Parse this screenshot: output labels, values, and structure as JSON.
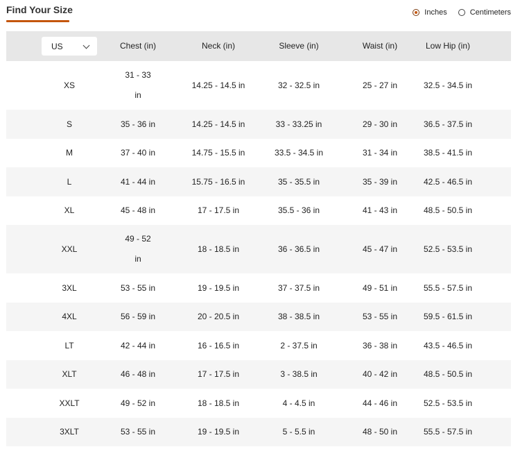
{
  "header": {
    "title": "Find Your Size",
    "units": [
      {
        "label": "Inches",
        "selected": true
      },
      {
        "label": "Centimeters",
        "selected": false
      }
    ]
  },
  "table": {
    "region_select": "US",
    "columns": [
      "Chest (in)",
      "Neck (in)",
      "Sleeve (in)",
      "Waist (in)",
      "Low Hip (in)"
    ],
    "rows": [
      {
        "size": "XS",
        "chest": [
          "31 - 33",
          "in"
        ],
        "neck": "14.25 - 14.5 in",
        "sleeve": "32 - 32.5 in",
        "waist": "25 - 27 in",
        "hip": "32.5 - 34.5 in"
      },
      {
        "size": "S",
        "chest": [
          "35 - 36 in"
        ],
        "neck": "14.25 - 14.5 in",
        "sleeve": "33 - 33.25 in",
        "waist": "29 - 30 in",
        "hip": "36.5 - 37.5 in"
      },
      {
        "size": "M",
        "chest": [
          "37 - 40 in"
        ],
        "neck": "14.75 - 15.5 in",
        "sleeve": "33.5 - 34.5 in",
        "waist": "31 - 34 in",
        "hip": "38.5 - 41.5 in"
      },
      {
        "size": "L",
        "chest": [
          "41 - 44 in"
        ],
        "neck": "15.75 - 16.5 in",
        "sleeve": "35 - 35.5 in",
        "waist": "35 - 39 in",
        "hip": "42.5 - 46.5 in"
      },
      {
        "size": "XL",
        "chest": [
          "45 - 48 in"
        ],
        "neck": "17 - 17.5 in",
        "sleeve": "35.5 - 36 in",
        "waist": "41 - 43 in",
        "hip": "48.5 - 50.5 in"
      },
      {
        "size": "XXL",
        "chest": [
          "49 - 52",
          "in"
        ],
        "neck": "18 - 18.5 in",
        "sleeve": "36 - 36.5 in",
        "waist": "45 - 47 in",
        "hip": "52.5 - 53.5 in"
      },
      {
        "size": "3XL",
        "chest": [
          "53 - 55 in"
        ],
        "neck": "19 - 19.5 in",
        "sleeve": "37 - 37.5 in",
        "waist": "49 - 51 in",
        "hip": "55.5 - 57.5 in"
      },
      {
        "size": "4XL",
        "chest": [
          "56 - 59 in"
        ],
        "neck": "20 - 20.5 in",
        "sleeve": "38 - 38.5 in",
        "waist": "53 - 55 in",
        "hip": "59.5 - 61.5 in"
      },
      {
        "size": "LT",
        "chest": [
          "42 - 44 in"
        ],
        "neck": "16 - 16.5 in",
        "sleeve": "2 - 37.5 in",
        "waist": "36 - 38 in",
        "hip": "43.5 - 46.5 in"
      },
      {
        "size": "XLT",
        "chest": [
          "46 - 48 in"
        ],
        "neck": "17 - 17.5 in",
        "sleeve": "3 - 38.5 in",
        "waist": "40 - 42 in",
        "hip": "48.5 - 50.5 in"
      },
      {
        "size": "XXLT",
        "chest": [
          "49 - 52 in"
        ],
        "neck": "18 - 18.5 in",
        "sleeve": "4 - 4.5 in",
        "waist": "44 - 46 in",
        "hip": "52.5 - 53.5 in"
      },
      {
        "size": "3XLT",
        "chest": [
          "53 - 55 in"
        ],
        "neck": "19 - 19.5 in",
        "sleeve": "5 - 5.5 in",
        "waist": "48 - 50 in",
        "hip": "55.5 - 57.5 in"
      }
    ]
  },
  "colors": {
    "accent": "#c4560d",
    "header_bg": "#e7e7e7",
    "alt_row_bg": "#f5f5f5"
  }
}
